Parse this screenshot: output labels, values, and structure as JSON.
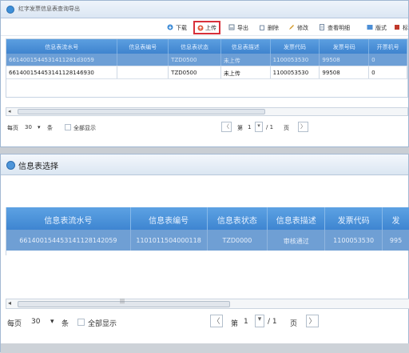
{
  "top": {
    "title": "红字发票信息表查询导出",
    "toolbar": {
      "download": "下载",
      "upload": "上传",
      "export": "导出",
      "delete": "删除",
      "edit": "修改",
      "view_detail": "查看明细",
      "style": "版式",
      "more": "标"
    },
    "columns": [
      "信息表流水号",
      "信息表编号",
      "信息表状态",
      "信息表描述",
      "发票代码",
      "发票号码",
      "开票机号"
    ],
    "rows": [
      [
        "6614001544531411281d3059",
        "",
        "TZD0500",
        "未上传",
        "1100053530",
        "99508",
        "0"
      ],
      [
        "661400154453141128146930",
        "",
        "TZD0500",
        "未上传",
        "1100053530",
        "99508",
        "0"
      ]
    ],
    "pager": {
      "per_page_label": "每页",
      "per_page_value": "30",
      "unit": "条",
      "show_all": "全部显示",
      "page_prefix": "第",
      "page_value": "1",
      "page_total": "/ 1",
      "page_suffix": "页"
    }
  },
  "bottom": {
    "title": "信息表选择",
    "columns": [
      "信息表流水号",
      "信息表编号",
      "信息表状态",
      "信息表描述",
      "发票代码",
      "发"
    ],
    "rows": [
      [
        "661400154453141128142059",
        "1101011504000118",
        "TZD0000",
        "审核通过",
        "1100053530",
        "995"
      ]
    ],
    "pager": {
      "per_page_label": "每页",
      "per_page_value": "30",
      "unit": "条",
      "show_all": "全部显示",
      "page_prefix": "第",
      "page_value": "1",
      "page_total": "/ 1",
      "page_suffix": "页"
    }
  },
  "colors": {
    "header_blue": "#4a8fd8",
    "selected_row": "#6f9fd4",
    "upload_highlight": "#d8303a"
  }
}
